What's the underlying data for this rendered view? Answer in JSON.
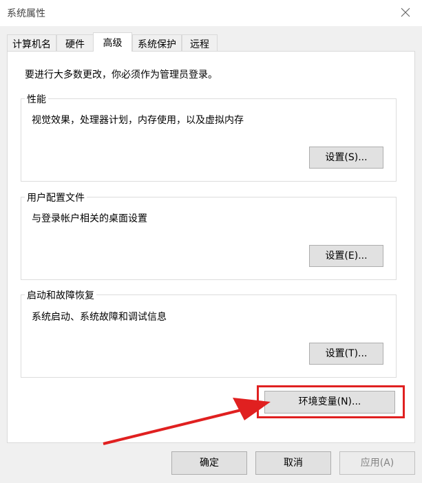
{
  "window": {
    "title": "系统属性"
  },
  "tabs": [
    "计算机名",
    "硬件",
    "高级",
    "系统保护",
    "远程"
  ],
  "active_tab": "高级",
  "intro": "要进行大多数更改，你必须作为管理员登录。",
  "groups": {
    "performance": {
      "title": "性能",
      "description": "视觉效果，处理器计划，内存使用，以及虚拟内存",
      "button": "设置(S)..."
    },
    "user_profiles": {
      "title": "用户配置文件",
      "description": "与登录帐户相关的桌面设置",
      "button": "设置(E)..."
    },
    "startup_recovery": {
      "title": "启动和故障恢复",
      "description": "系统启动、系统故障和调试信息",
      "button": "设置(T)..."
    }
  },
  "env_button": "环境变量(N)...",
  "footer": {
    "ok": "确定",
    "cancel": "取消",
    "apply": "应用(A)"
  },
  "annotation": {
    "highlight_color": "#e02020"
  }
}
